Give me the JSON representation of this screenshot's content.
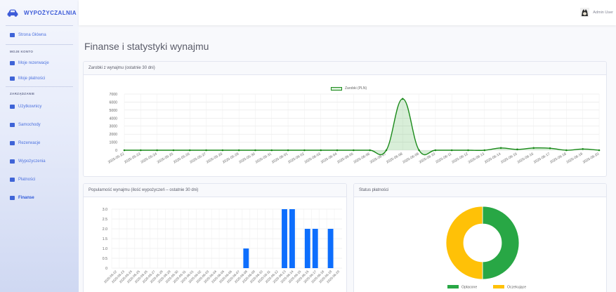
{
  "brand": {
    "name": "WYPOŻYCZALNIA"
  },
  "sidebar": {
    "main_item": "Strona Główna",
    "section1": "MOJE KONTO",
    "account_items": [
      "Moje rezerwacje",
      "Moje płatności"
    ],
    "section2": "ZARZĄDZANIE",
    "admin_items": [
      "Użytkownicy",
      "Samochody",
      "Rezerwacje",
      "Wypożyczenia",
      "Płatności",
      "Finanse"
    ],
    "active": "Finanse"
  },
  "topbar": {
    "user_name": "Admin User"
  },
  "page": {
    "title": "Finanse i statystyki wynajmu"
  },
  "cards": {
    "earnings": "Zarobki z wynajmu (ostatnie 30 dni)",
    "popularity": "Popularność wynajmu (ilość wypożyczeń – ostatnie 30 dni)",
    "payment_status": "Status płatności"
  },
  "colors": {
    "earnings": "#1a8a1a",
    "bars": "#0d6efd",
    "paid": "#28a745",
    "pending": "#ffc107"
  },
  "chart_data": [
    {
      "type": "line",
      "legend": [
        "Zarobki (PLN)"
      ],
      "x": [
        "2025-05-22",
        "2025-05-23",
        "2025-05-24",
        "2025-05-25",
        "2025-05-26",
        "2025-05-27",
        "2025-05-28",
        "2025-05-29",
        "2025-05-30",
        "2025-05-31",
        "2025-06-01",
        "2025-06-02",
        "2025-06-03",
        "2025-06-04",
        "2025-06-05",
        "2025-06-06",
        "2025-06-07",
        "2025-06-08",
        "2025-06-09",
        "2025-06-10",
        "2025-06-11",
        "2025-06-12",
        "2025-06-13",
        "2025-06-14",
        "2025-06-15",
        "2025-06-16",
        "2025-06-17",
        "2025-06-18",
        "2025-06-19",
        "2025-06-20"
      ],
      "y_ticks": [
        "0",
        "1000",
        "2000",
        "3000",
        "4000",
        "5000",
        "6000",
        "7000"
      ],
      "series": [
        {
          "name": "Zarobki (PLN)",
          "values": [
            0,
            0,
            0,
            0,
            0,
            0,
            0,
            0,
            0,
            0,
            0,
            0,
            0,
            0,
            0,
            0,
            0,
            6400,
            0,
            0,
            0,
            0,
            0,
            280,
            100,
            280,
            250,
            0,
            150,
            0
          ]
        }
      ],
      "ylim": [
        0,
        7000
      ]
    },
    {
      "type": "bar",
      "x": [
        "2025-05-22",
        "2025-05-23",
        "2025-05-24",
        "2025-05-25",
        "2025-05-26",
        "2025-05-27",
        "2025-05-28",
        "2025-05-29",
        "2025-05-30",
        "2025-05-31",
        "2025-06-01",
        "2025-06-02",
        "2025-06-03",
        "2025-06-04",
        "2025-06-05",
        "2025-06-06",
        "2025-06-07",
        "2025-06-08",
        "2025-06-09",
        "2025-06-10",
        "2025-06-11",
        "2025-06-12",
        "2025-06-13",
        "2025-06-14",
        "2025-06-15",
        "2025-06-16",
        "2025-06-17",
        "2025-06-18",
        "2025-06-19",
        "2025-06-20"
      ],
      "y_ticks": [
        "0",
        "0.5",
        "1.0",
        "1.5",
        "2.0",
        "2.5",
        "3.0"
      ],
      "values": [
        0,
        0,
        0,
        0,
        0,
        0,
        0,
        0,
        0,
        0,
        0,
        0,
        0,
        0,
        0,
        0,
        0,
        1,
        0,
        0,
        0,
        0,
        3,
        3,
        0,
        2,
        2,
        0,
        2,
        0
      ],
      "ylim": [
        0,
        3
      ]
    },
    {
      "type": "pie",
      "legend": [
        "Opłacone",
        "Oczekujące"
      ],
      "values": [
        50,
        50
      ]
    }
  ]
}
